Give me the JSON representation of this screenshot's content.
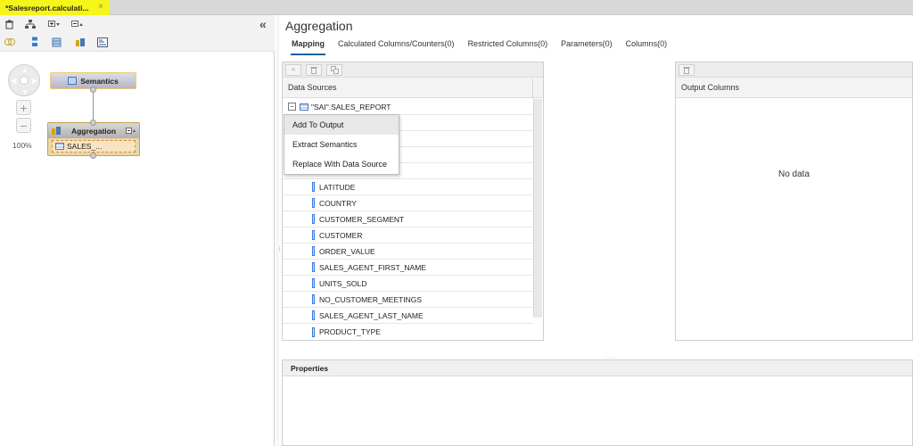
{
  "editor_tab": {
    "label": "*Salesreport.calculati...",
    "close": "×"
  },
  "left_toolbar": {
    "icons": [
      "delete-icon",
      "auto-layout-icon",
      "expand-all-icon",
      "collapse-all-icon",
      "join-icon",
      "union-icon",
      "projection-icon",
      "aggregation-icon",
      "rank-icon"
    ],
    "collapse_label": "«"
  },
  "canvas": {
    "zoom_in": "+",
    "zoom_out": "−",
    "zoom_level": "100%",
    "semantics_node": {
      "label": "Semantics"
    },
    "aggregation_node": {
      "label": "Aggregation",
      "datasource": "SALES_..."
    }
  },
  "main": {
    "title": "Aggregation",
    "tabs": [
      {
        "label": "Mapping",
        "active": true
      },
      {
        "label": "Calculated Columns/Counters(0)"
      },
      {
        "label": "Restricted Columns(0)"
      },
      {
        "label": "Parameters(0)"
      },
      {
        "label": "Columns(0)"
      }
    ],
    "data_sources": {
      "header": "Data Sources",
      "root": "\"SAI\".SALES_REPORT",
      "columns": [
        "LATITUDE",
        "COUNTRY",
        "CUSTOMER_SEGMENT",
        "CUSTOMER",
        "ORDER_VALUE",
        "SALES_AGENT_FIRST_NAME",
        "UNITS_SOLD",
        "NO_CUSTOMER_MEETINGS",
        "SALES_AGENT_LAST_NAME",
        "PRODUCT_TYPE"
      ]
    },
    "output_columns": {
      "header": "Output Columns",
      "empty_text": "No data"
    },
    "context_menu": [
      "Add To Output",
      "Extract Semantics",
      "Replace With Data Source"
    ],
    "properties": {
      "header": "Properties"
    }
  }
}
